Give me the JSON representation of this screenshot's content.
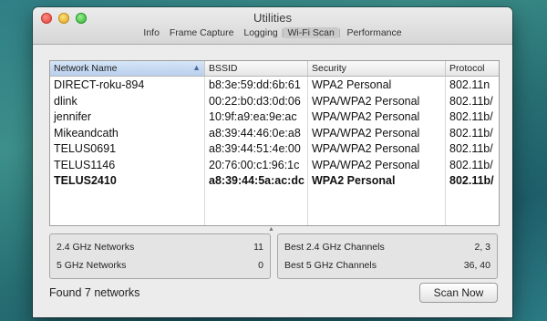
{
  "window": {
    "title": "Utilities",
    "tabs": [
      {
        "label": "Info",
        "active": false
      },
      {
        "label": "Frame Capture",
        "active": false
      },
      {
        "label": "Logging",
        "active": false
      },
      {
        "label": "Wi-Fi Scan",
        "active": true
      },
      {
        "label": "Performance",
        "active": false
      }
    ]
  },
  "table": {
    "columns": [
      "Network Name",
      "BSSID",
      "Security",
      "Protocol"
    ],
    "sorted_column": "Network Name",
    "rows": [
      {
        "name": "DIRECT-roku-894",
        "bssid": "b8:3e:59:dd:6b:61",
        "security": "WPA2 Personal",
        "protocol": "802.11n"
      },
      {
        "name": "dlink",
        "bssid": "00:22:b0:d3:0d:06",
        "security": "WPA/WPA2 Personal",
        "protocol": "802.11b/"
      },
      {
        "name": "jennifer",
        "bssid": "10:9f:a9:ea:9e:ac",
        "security": "WPA/WPA2 Personal",
        "protocol": "802.11b/"
      },
      {
        "name": "Mikeandcath",
        "bssid": "a8:39:44:46:0e:a8",
        "security": "WPA/WPA2 Personal",
        "protocol": "802.11b/"
      },
      {
        "name": "TELUS0691",
        "bssid": "a8:39:44:51:4e:00",
        "security": "WPA/WPA2 Personal",
        "protocol": "802.11b/"
      },
      {
        "name": "TELUS1146",
        "bssid": "20:76:00:c1:96:1c",
        "security": "WPA/WPA2 Personal",
        "protocol": "802.11b/"
      },
      {
        "name": "TELUS2410",
        "bssid": "a8:39:44:5a:ac:dc",
        "security": "WPA2 Personal",
        "protocol": "802.11b/"
      }
    ]
  },
  "summary_left": [
    {
      "label": "2.4 GHz Networks",
      "value": "11"
    },
    {
      "label": "5 GHz Networks",
      "value": "0"
    }
  ],
  "summary_right": [
    {
      "label": "Best 2.4 GHz Channels",
      "value": "2, 3"
    },
    {
      "label": "Best 5 GHz Channels",
      "value": "36, 40"
    }
  ],
  "status": {
    "found_text": "Found 7 networks"
  },
  "scan_button": {
    "label": "Scan Now"
  }
}
